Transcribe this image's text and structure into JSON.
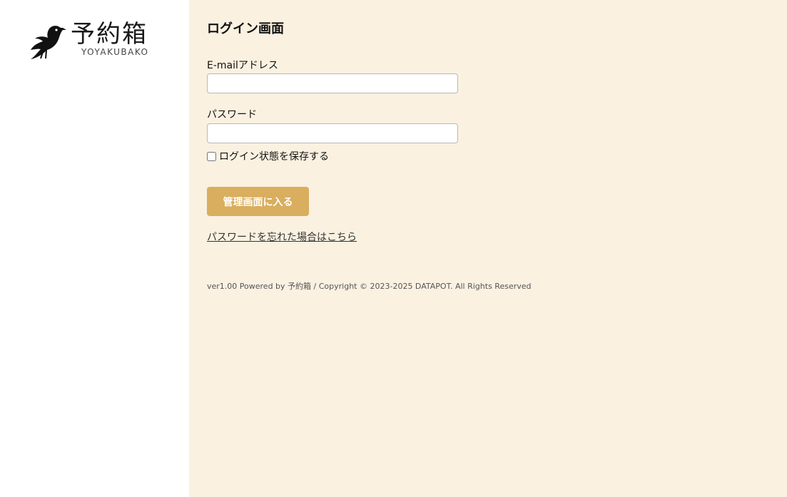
{
  "brand": {
    "logo_kanji": "予約箱",
    "logo_roman": "YOYAKUBAKO"
  },
  "page": {
    "title": "ログイン画面"
  },
  "form": {
    "email_label": "E-mailアドレス",
    "email_value": "",
    "password_label": "パスワード",
    "password_value": "",
    "remember_label": "ログイン状態を保存する",
    "remember_checked": false,
    "submit_label": "管理画面に入る",
    "forgot_link": "パスワードを忘れた場合はこちら"
  },
  "footer": {
    "text": "ver1.00 Powered by 予約箱 / Copyright © 2023-2025 DATAPOT. All Rights Reserved"
  },
  "colors": {
    "main_bg": "#faf1e1",
    "button_bg": "#d9ae5e"
  }
}
